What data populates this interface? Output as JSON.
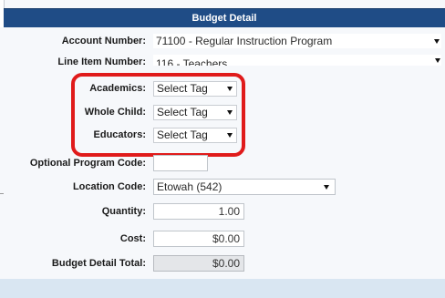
{
  "header": {
    "title": "Budget Detail"
  },
  "fields": {
    "account_number": {
      "label": "Account Number:",
      "value": "71100 - Regular Instruction Program"
    },
    "line_item_number": {
      "label": "Line Item Number:",
      "value": "116 - Teachers"
    },
    "academics": {
      "label": "Academics:",
      "value": "Select Tag"
    },
    "whole_child": {
      "label": "Whole Child:",
      "value": "Select Tag"
    },
    "educators": {
      "label": "Educators:",
      "value": "Select Tag"
    },
    "optional_program_code": {
      "label": "Optional Program Code:",
      "value": ""
    },
    "location_code": {
      "label": "Location Code:",
      "value": "Etowah (542)"
    },
    "quantity": {
      "label": "Quantity:",
      "value": "1.00"
    },
    "cost": {
      "label": "Cost:",
      "value": "$0.00"
    },
    "budget_detail_total": {
      "label": "Budget Detail Total:",
      "value": "$0.00"
    }
  },
  "colors": {
    "header_bg": "#1f4c86",
    "highlight": "#e01b1b",
    "footer_band": "#d9e6f2"
  },
  "icons": {
    "dropdown": "chevron-down-icon"
  }
}
